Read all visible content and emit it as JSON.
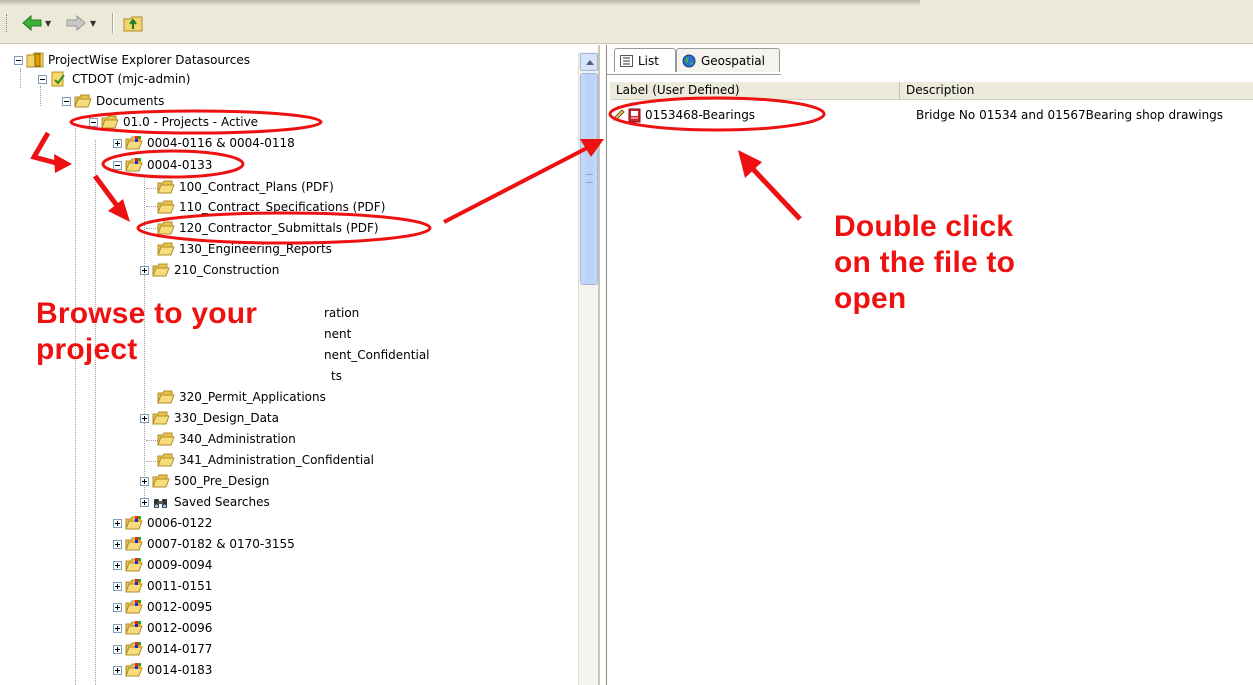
{
  "tree": {
    "root": "ProjectWise Explorer Datasources",
    "datasource": "CTDOT (mjc-admin)",
    "documents": "Documents",
    "projects_active": "01.0 - Projects - Active",
    "project_a": "0004-0116 & 0004-0118",
    "project_b": "0004-0133",
    "folders": {
      "f100": "100_Contract_Plans (PDF)",
      "f110": "110_Contract_Specifications (PDF)",
      "f120": "120_Contractor_Submittals (PDF)",
      "f130": "130_Engineering_Reports",
      "f210": "210_Construction",
      "frag1": "ration",
      "frag2": "nent",
      "frag3": "nent_Confidential",
      "frag4": "ts",
      "f320": "320_Permit_Applications",
      "f330": "330_Design_Data",
      "f340": "340_Administration",
      "f341": "341_Administration_Confidential",
      "f500": "500_Pre_Design",
      "saved": "Saved Searches"
    },
    "other_projects": [
      "0006-0122",
      "0007-0182 & 0170-3155",
      "0009-0094",
      "0011-0151",
      "0012-0095",
      "0012-0096",
      "0014-0177",
      "0014-0183"
    ]
  },
  "tabs": {
    "list": "List",
    "geospatial": "Geospatial"
  },
  "list": {
    "col_label": "Label (User Defined)",
    "col_description": "Description",
    "rows": [
      {
        "label": "0153468-Bearings",
        "description": "Bridge No 01534 and 01567Bearing shop drawings"
      }
    ]
  },
  "annotations": {
    "browse_line1": "Browse to your",
    "browse_line2": "project",
    "open_line1": "Double click",
    "open_line2": "on the file to",
    "open_line3": "open"
  },
  "colors": {
    "annotation_red": "#ee1111",
    "folder_yellow": "#f3d36b"
  }
}
